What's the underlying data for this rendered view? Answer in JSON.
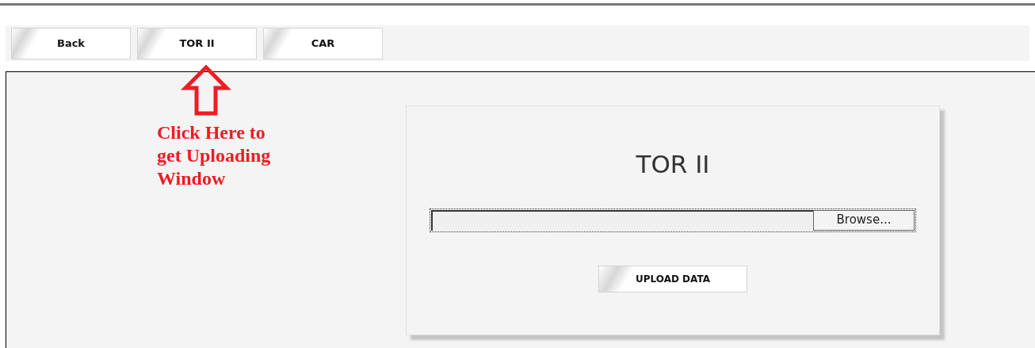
{
  "toolbar": {
    "buttons": [
      {
        "label": "Back"
      },
      {
        "label": "TOR II"
      },
      {
        "label": "CAR"
      }
    ]
  },
  "annotation": {
    "text": "Click Here to get Uploading Window"
  },
  "upload_card": {
    "title": "TOR II",
    "file_field": {
      "button": "Browse..."
    },
    "submit": "UPLOAD DATA"
  }
}
